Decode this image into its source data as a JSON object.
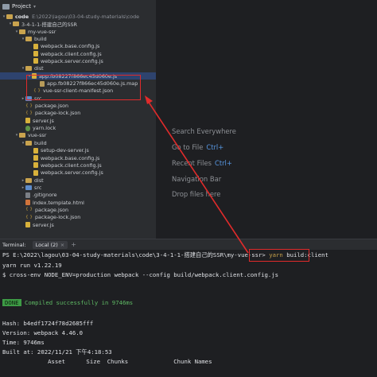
{
  "project": {
    "header_title": "Project",
    "root_name": "code",
    "root_path": "E:\\2022\\lagou\\03-04-study-materials\\code"
  },
  "tree": [
    {
      "label": "3-4-1-1-搭建自己的SSR",
      "type": "folder",
      "arrow": "down"
    },
    {
      "label": "my-vue-ssr",
      "type": "folder",
      "arrow": "down"
    },
    {
      "label": "build",
      "type": "folder",
      "arrow": "down"
    },
    {
      "label": "webpack.base.config.js",
      "type": "js",
      "arrow": "none"
    },
    {
      "label": "webpack.client.config.js",
      "type": "js",
      "arrow": "none"
    },
    {
      "label": "webpack.server.config.js",
      "type": "js",
      "arrow": "none"
    },
    {
      "label": "dist",
      "type": "folder",
      "arrow": "down"
    },
    {
      "label": "app.fb08227f866ec45d060e.js",
      "type": "js",
      "arrow": "down",
      "selected": true
    },
    {
      "label": "app.fb08227f866ec45d060e.js.map",
      "type": "map",
      "arrow": "none"
    },
    {
      "label": "vue-ssr-client-manifest.json",
      "type": "json",
      "arrow": "none"
    },
    {
      "label": "src",
      "type": "folder-blue",
      "arrow": "right"
    },
    {
      "label": "package.json",
      "type": "json",
      "arrow": "none"
    },
    {
      "label": "package-lock.json",
      "type": "json",
      "arrow": "none"
    },
    {
      "label": "server.js",
      "type": "js",
      "arrow": "none"
    },
    {
      "label": "yarn.lock",
      "type": "lock",
      "arrow": "none"
    },
    {
      "label": "vue-ssr",
      "type": "folder",
      "arrow": "down"
    },
    {
      "label": "build",
      "type": "folder",
      "arrow": "down"
    },
    {
      "label": "setup-dev-server.js",
      "type": "js",
      "arrow": "none"
    },
    {
      "label": "webpack.base.config.js",
      "type": "js",
      "arrow": "none"
    },
    {
      "label": "webpack.client.config.js",
      "type": "js",
      "arrow": "none"
    },
    {
      "label": "webpack.server.config.js",
      "type": "js",
      "arrow": "none"
    },
    {
      "label": "dist",
      "type": "folder",
      "arrow": "right"
    },
    {
      "label": "src",
      "type": "folder-blue",
      "arrow": "right"
    },
    {
      "label": ".gitignore",
      "type": "git",
      "arrow": "none"
    },
    {
      "label": "index.template.html",
      "type": "html",
      "arrow": "none"
    },
    {
      "label": "package.json",
      "type": "json",
      "arrow": "none"
    },
    {
      "label": "package-lock.json",
      "type": "json",
      "arrow": "none"
    },
    {
      "label": "server.js",
      "type": "js",
      "arrow": "none"
    }
  ],
  "editor_hints": [
    {
      "text": "Search Everywhere",
      "key": ""
    },
    {
      "text": "Go to File",
      "key": "Ctrl+"
    },
    {
      "text": "Recent Files",
      "key": "Ctrl+"
    },
    {
      "text": "Navigation Bar",
      "key": ""
    },
    {
      "text": "Drop files here",
      "key": ""
    }
  ],
  "tool_window": {
    "title": "Terminal:",
    "tab_label": "Local (2)",
    "close_glyph": "×",
    "add_glyph": "+"
  },
  "terminal": {
    "prompt": "PS E:\\2022\\lagou\\03-04-study-materials\\code\\3-4-1-1-搭建自己的SSR\\my-vue-ssr>",
    "command_yarn": "yarn",
    "command_rest": " build:client",
    "line_yarn_run": "yarn run v1.22.19",
    "line_cross_env": "$ cross-env NODE_ENV=production webpack --config build/webpack.client.config.js",
    "done_badge": "DONE",
    "done_message": " Compiled successfully in 9746ms",
    "hash_line": "Hash: b4edf1724f78d2685fff",
    "version_line": "Version: webpack 4.46.0",
    "time_line": "Time: 9746ms",
    "built_line": "Built at: 2022/11/21 下午4:18:53",
    "table_header": "             Asset      Size  Chunks             Chunk Names"
  }
}
